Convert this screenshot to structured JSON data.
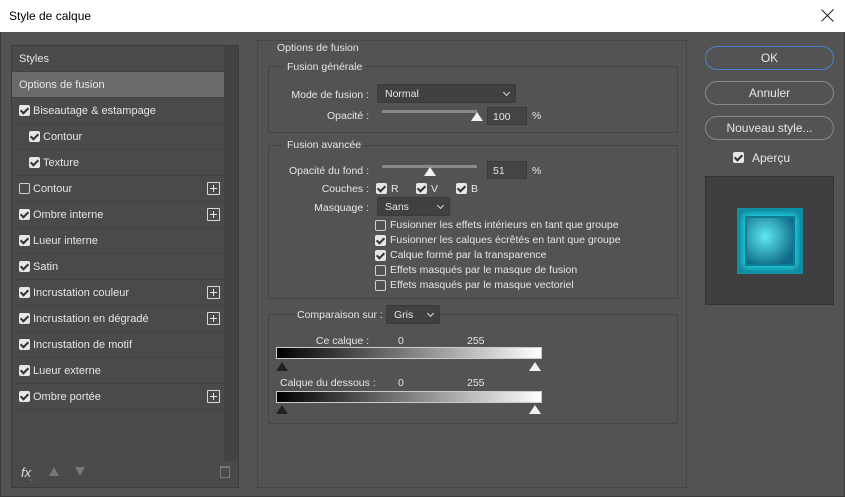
{
  "window": {
    "title": "Style de calque"
  },
  "styles_panel": {
    "header": "Styles",
    "items": [
      {
        "label": "Options de fusion",
        "selected": true,
        "checkbox": null,
        "plus": false,
        "indent": 0
      },
      {
        "label": "Biseautage & estampage",
        "checkbox": true,
        "plus": false,
        "indent": 0
      },
      {
        "label": "Contour",
        "checkbox": true,
        "plus": false,
        "indent": 1
      },
      {
        "label": "Texture",
        "checkbox": true,
        "plus": false,
        "indent": 1
      },
      {
        "label": "Contour",
        "checkbox": false,
        "plus": true,
        "indent": 0
      },
      {
        "label": "Ombre interne",
        "checkbox": true,
        "plus": true,
        "indent": 0
      },
      {
        "label": "Lueur interne",
        "checkbox": true,
        "plus": false,
        "indent": 0
      },
      {
        "label": "Satin",
        "checkbox": true,
        "plus": false,
        "indent": 0
      },
      {
        "label": "Incrustation couleur",
        "checkbox": true,
        "plus": true,
        "indent": 0
      },
      {
        "label": "Incrustation en dégradé",
        "checkbox": true,
        "plus": true,
        "indent": 0
      },
      {
        "label": "Incrustation de motif",
        "checkbox": true,
        "plus": false,
        "indent": 0
      },
      {
        "label": "Lueur externe",
        "checkbox": true,
        "plus": false,
        "indent": 0
      },
      {
        "label": "Ombre portée",
        "checkbox": true,
        "plus": true,
        "indent": 0
      }
    ],
    "footer": {
      "fx_label": "fx",
      "fx_sub": "."
    }
  },
  "options": {
    "title": "Options de fusion",
    "general": {
      "title": "Fusion générale",
      "mode_label": "Mode de fusion :",
      "mode_value": "Normal",
      "opacity_label": "Opacité :",
      "opacity_value": "100",
      "opacity_pct": 100,
      "unit": "%"
    },
    "advanced": {
      "title": "Fusion avancée",
      "fill_label": "Opacité du fond :",
      "fill_value": "51",
      "fill_pct": 51,
      "unit": "%",
      "channels_label": "Couches :",
      "channels": [
        {
          "label": "R",
          "checked": true
        },
        {
          "label": "V",
          "checked": true
        },
        {
          "label": "B",
          "checked": true
        }
      ],
      "knockout_label": "Masquage :",
      "knockout_value": "Sans",
      "options": [
        {
          "label": "Fusionner les effets intérieurs en tant que groupe",
          "checked": false
        },
        {
          "label": "Fusionner les calques écrêtés en tant que groupe",
          "checked": true
        },
        {
          "label": "Calque formé par la transparence",
          "checked": true
        },
        {
          "label": "Effets masqués par le masque de fusion",
          "checked": false
        },
        {
          "label": "Effets masqués par le masque vectoriel",
          "checked": false
        }
      ]
    },
    "blend_if": {
      "label": "Comparaison sur :",
      "value": "Gris",
      "this_layer": {
        "label": "Ce calque :",
        "low": "0",
        "high": "255"
      },
      "underlying": {
        "label": "Calque du dessous :",
        "low": "0",
        "high": "255"
      }
    }
  },
  "buttons": {
    "ok": "OK",
    "cancel": "Annuler",
    "new_style": "Nouveau style...",
    "preview_label": "Aperçu",
    "preview_checked": true
  }
}
